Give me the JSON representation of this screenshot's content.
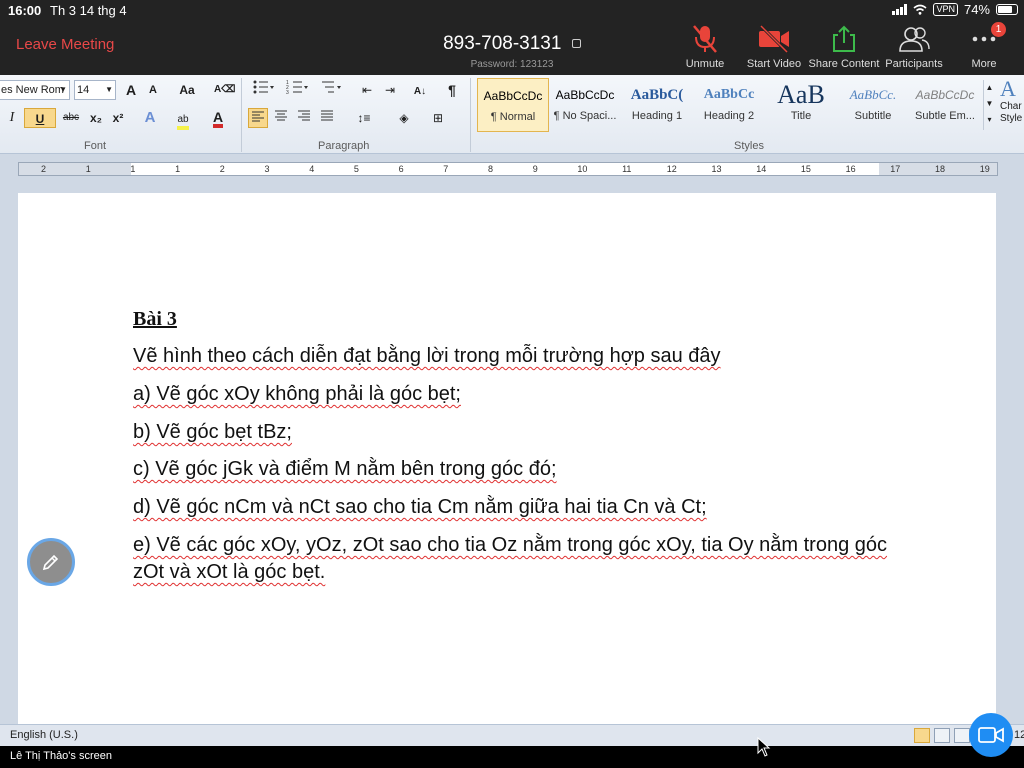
{
  "status_bar": {
    "time": "16:00",
    "date": "Th 3 14 thg 4",
    "vpn": "VPN",
    "battery": "74%"
  },
  "meeting": {
    "leave_label": "Leave Meeting",
    "id": "893-708-3131",
    "password": "Password: 123123",
    "controls": {
      "unmute": "Unmute",
      "start_video": "Start Video",
      "share_content": "Share Content",
      "participants": "Participants",
      "more": "More",
      "more_badge": "1"
    }
  },
  "ribbon": {
    "font_name": "es New Rom",
    "font_size": "14",
    "grow_font": "A",
    "shrink_font": "A",
    "change_case": "Aa",
    "italic": "I",
    "underline": "U",
    "strikethrough": "abc",
    "subscript": "x₂",
    "superscript": "x²",
    "pilcrow": "¶",
    "groups": {
      "font": "Font",
      "paragraph": "Paragraph",
      "styles": "Styles"
    },
    "styles": [
      {
        "sample": "AaBbCcDc",
        "name": "¶ Normal"
      },
      {
        "sample": "AaBbCcDc",
        "name": "¶ No Spaci..."
      },
      {
        "sample": "AaBbC(",
        "name": "Heading 1"
      },
      {
        "sample": "AaBbCc",
        "name": "Heading 2"
      },
      {
        "sample": "AaB",
        "name": "Title"
      },
      {
        "sample": "AaBbCc.",
        "name": "Subtitle"
      },
      {
        "sample": "AaBbCcDc",
        "name": "Subtle Em..."
      }
    ],
    "change_styles": [
      "Char",
      "Style"
    ]
  },
  "ruler": {
    "numbers": [
      "2",
      "1",
      "1",
      "1",
      "2",
      "3",
      "4",
      "5",
      "6",
      "7",
      "8",
      "9",
      "10",
      "11",
      "12",
      "13",
      "14",
      "15",
      "16",
      "17",
      "18",
      "19"
    ]
  },
  "document": {
    "title": "Bài 3",
    "lines": [
      "Vẽ hình theo cách diễn đạt bằng lời trong mỗi trường hợp sau đây",
      "a) Vẽ góc xOy không phải là góc bẹt;",
      "b) Vẽ góc bẹt tBz;",
      "c) Vẽ góc jGk và điểm M nằm bên trong góc đó;",
      "d) Vẽ góc nCm và nCt sao cho tia Cm nằm giữa hai tia Cn và Ct;",
      "e) Vẽ các góc xOy, yOz, zOt sao cho tia Oz nằm trong góc xOy, tia Oy nằm trong góc zOt và xOt là góc bẹt."
    ]
  },
  "word_status": {
    "language": "English (U.S.)",
    "zoom": "12"
  },
  "screen_owner": "Lê Thị Thảo's screen",
  "colors": {
    "zoom_bar": "#232323",
    "leave": "#e84848",
    "unmute_red": "#e8443a",
    "share_green": "#3dbb4b",
    "accent_blue": "#1f8df3"
  }
}
